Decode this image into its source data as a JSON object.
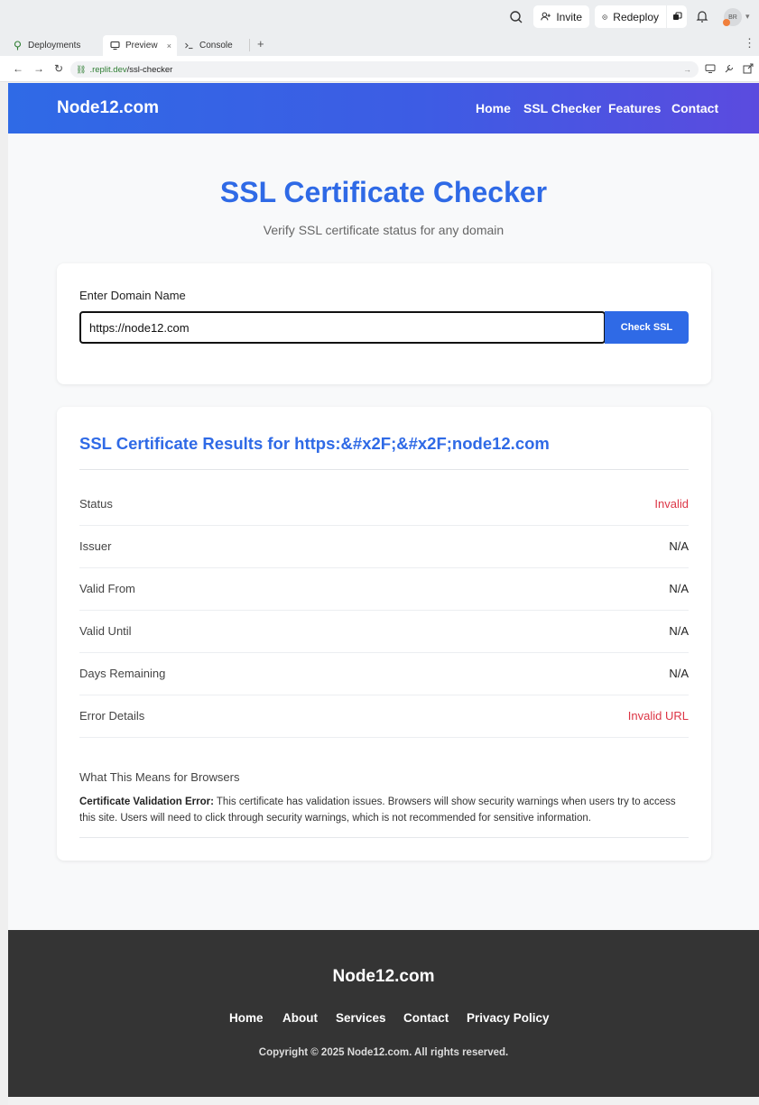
{
  "topbar": {
    "invite_label": "Invite",
    "redeploy_label": "Redeploy",
    "avatar_initials": "BR",
    "colors": {
      "avatar_dot": "#f07f3c"
    }
  },
  "tabs": [
    {
      "label": "Deployments",
      "icon": "deployments-icon"
    },
    {
      "label": "Preview",
      "icon": "monitor-icon",
      "close": "×"
    },
    {
      "label": "Console",
      "icon": "terminal-icon"
    }
  ],
  "address": {
    "host": ".replit.dev",
    "path": "/ssl-checker"
  },
  "site": {
    "brand": "Node12.com",
    "nav": [
      "Home",
      "SSL Checker",
      "Features",
      "Contact"
    ],
    "title": "SSL Certificate Checker",
    "subtitle": "Verify SSL certificate status for any domain",
    "form": {
      "label": "Enter Domain Name",
      "value": "https://node12.com",
      "button": "Check SSL"
    },
    "results": {
      "title": "SSL Certificate Results for https:&#x2F;&#x2F;node12.com",
      "rows": [
        {
          "key": "Status",
          "value": "Invalid",
          "status": "bad"
        },
        {
          "key": "Issuer",
          "value": "N/A",
          "status": "normal"
        },
        {
          "key": "Valid From",
          "value": "N/A",
          "status": "normal"
        },
        {
          "key": "Valid Until",
          "value": "N/A",
          "status": "normal"
        },
        {
          "key": "Days Remaining",
          "value": "N/A",
          "status": "normal"
        },
        {
          "key": "Error Details",
          "value": "Invalid URL",
          "status": "bad"
        }
      ],
      "browsers_heading": "What This Means for Browsers",
      "browsers_strong": "Certificate Validation Error:",
      "browsers_text": " This certificate has validation issues. Browsers will show security warnings when users try to access this site. Users will need to click through security warnings, which is not recommended for sensitive information."
    },
    "footer": {
      "brand": "Node12.com",
      "links": [
        "Home",
        "About",
        "Services",
        "Contact",
        "Privacy Policy"
      ],
      "copyright": "Copyright © 2025 Node12.com. All rights reserved."
    },
    "colors": {
      "primary": "#2f6ae6",
      "header_gradient_end": "#5b4bdf",
      "error": "#dc3545",
      "footer_bg": "#343434"
    }
  }
}
